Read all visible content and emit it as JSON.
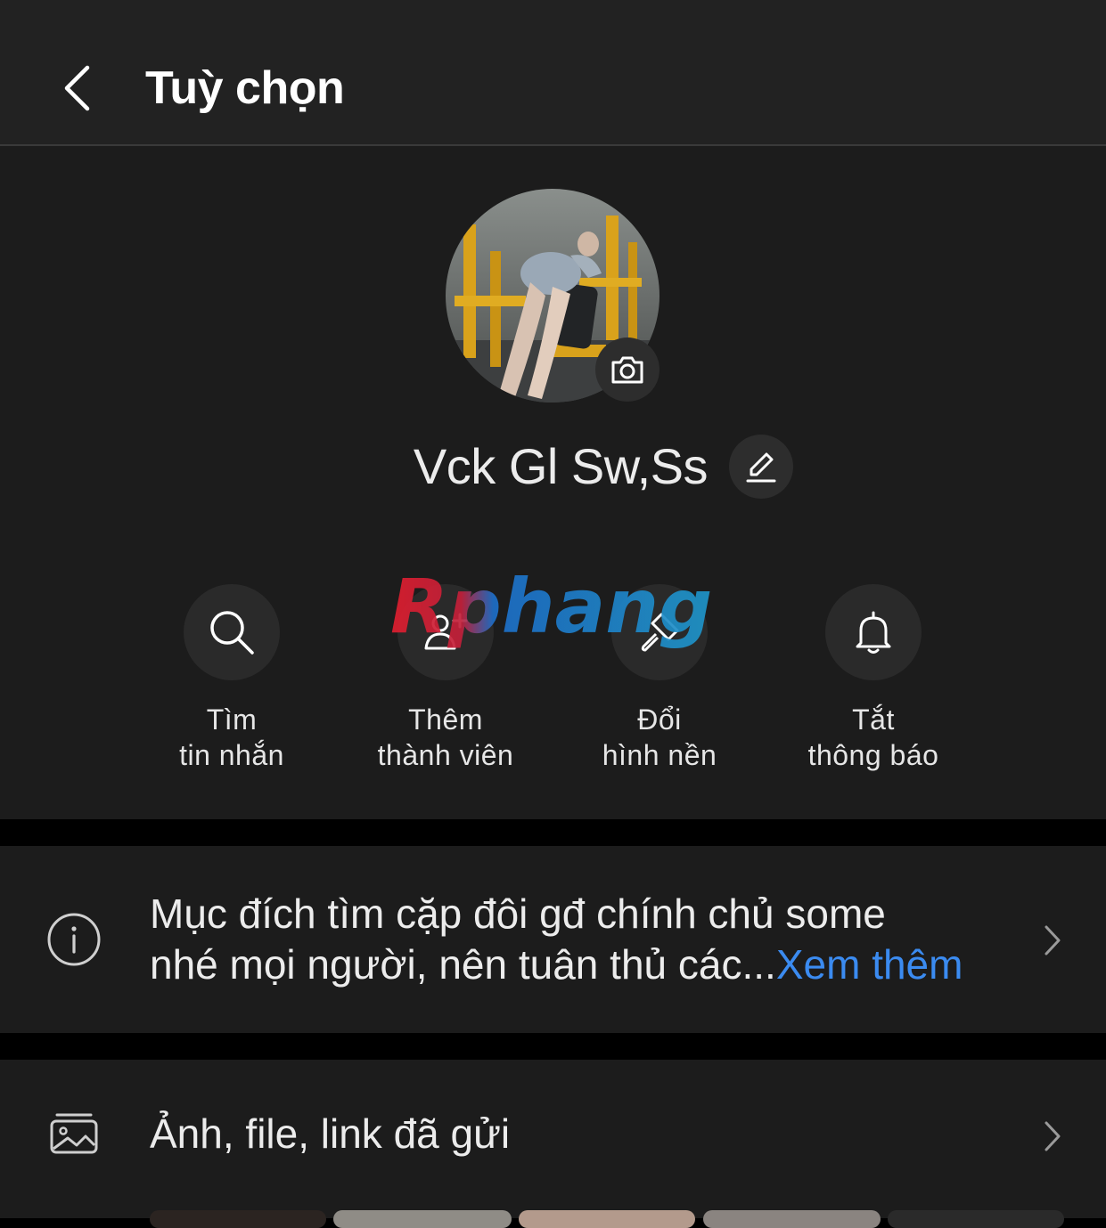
{
  "header": {
    "title": "Tuỳ chọn"
  },
  "profile": {
    "name": "Vck Gl Sw,Ss"
  },
  "actions": [
    {
      "line1": "Tìm",
      "line2": "tin nhắn",
      "icon": "search-icon"
    },
    {
      "line1": "Thêm",
      "line2": "thành viên",
      "icon": "add-member-icon"
    },
    {
      "line1": "Đổi",
      "line2": "hình nền",
      "icon": "paint-brush-icon"
    },
    {
      "line1": "Tắt",
      "line2": "thông báo",
      "icon": "bell-icon"
    }
  ],
  "watermark": {
    "text": "Rphang"
  },
  "description": {
    "line1": "Mục đích tìm cặp đôi gđ chính chủ some",
    "line2": "nhé mọi người, nên tuân thủ các...",
    "see_more": "Xem thêm"
  },
  "media": {
    "label": "Ảnh, file, link đã gửi"
  },
  "colors": {
    "accent": "#3b8bf0",
    "header_bg": "#222222",
    "section_bg": "#1c1c1c",
    "page_bg": "#000000"
  }
}
